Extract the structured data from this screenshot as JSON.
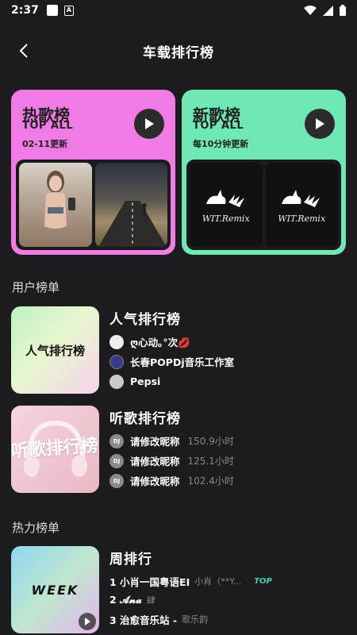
{
  "status_bar": {
    "time": "2:37",
    "a_icon": "A"
  },
  "header": {
    "title": "车载排行榜"
  },
  "top_cards": [
    {
      "title": "热歌榜",
      "subtitle": "TOP ALL",
      "update": "02-11更新",
      "color": "#f17be6"
    },
    {
      "title": "新歌榜",
      "subtitle": "TOP ALL",
      "update": "每10分钟更新",
      "color": "#6ee9b4",
      "cover_text": "WIT.Remix"
    }
  ],
  "sections": {
    "user": "用户榜单",
    "hot": "热力榜单"
  },
  "user_ranks": [
    {
      "name": "人气排行榜",
      "cover_text": "人气排行榜",
      "items": [
        {
          "name": "ღ心动｡°次💋"
        },
        {
          "name": "长春POPDj音乐工作室"
        },
        {
          "name": "Pepsi"
        }
      ]
    },
    {
      "name": "听歌排行榜",
      "cover_text": "听歌排行榜",
      "avatar_label": "DJ",
      "items": [
        {
          "name": "请修改昵称",
          "time": "150.9小时"
        },
        {
          "name": "请修改昵称",
          "time": "125.1小时"
        },
        {
          "name": "请修改昵称",
          "time": "102.4小时"
        }
      ]
    }
  ],
  "hot_ranks": [
    {
      "name": "周排行",
      "cover_text": "WEEK",
      "songs": [
        {
          "title": "1 小肖一国粤语EI",
          "artist": "小肖（**Y...",
          "badge": "TOP"
        },
        {
          "title": "2 𝓐𝓷𝓪",
          "artist": "肆"
        },
        {
          "title": "3 治愈音乐站 -",
          "artist": "歌乐韵"
        }
      ]
    }
  ]
}
